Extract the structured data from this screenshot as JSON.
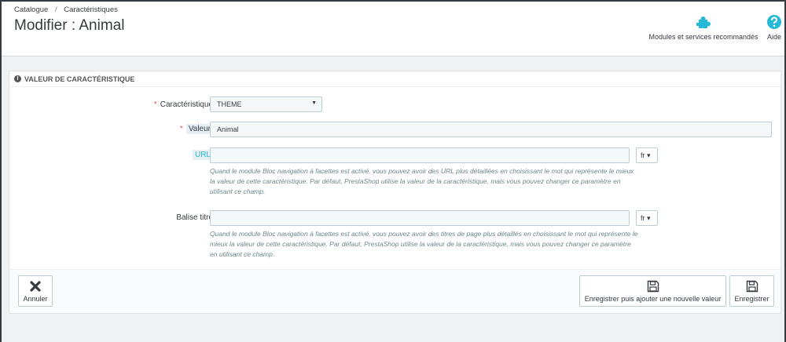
{
  "breadcrumb": {
    "item1": "Catalogue",
    "separator": "/",
    "item2": "Caractéristiques"
  },
  "page_title": "Modifier : Animal",
  "toolbar": {
    "modules_label": "Modules et services recommandés",
    "help_label": "Aide"
  },
  "panel": {
    "heading": "VALEUR DE CARACTÉRISTIQUE",
    "info_glyph": "i",
    "fields": {
      "feature": {
        "required_mark": "*",
        "label": "Caractéristique",
        "selected": "THEME",
        "caret": "▼"
      },
      "value": {
        "required_mark": "*",
        "label": "Valeur",
        "value": "Animal"
      },
      "url": {
        "label": "URL",
        "value": "",
        "lang": "fr ▾",
        "help": "Quand le module Bloc navigation à facettes est activé, vous pouvez avoir des URL plus détaillées en choisissant le mot qui représente le mieux la valeur de cette caractéristique. Par défaut, PrestaShop utilise la valeur de la caractéristique, mais vous pouvez changer ce paramètre en utilisant ce champ."
      },
      "meta_title": {
        "label": "Balise titre",
        "value": "",
        "lang": "fr ▾",
        "help": "Quand le module Bloc navigation à facettes est activé, vous pouvez avoir des titres de page plus détaillés en choisissant le mot qui représente le mieux la valeur de cette caractéristique. Par défaut, PrestaShop utilise la valeur de la caractéristique, mais vous pouvez changer ce paramètre en utilisant ce champ."
      }
    }
  },
  "footer": {
    "cancel_label": "Annuler",
    "save_and_add_label": "Enregistrer puis ajouter une nouvelle valeur",
    "save_label": "Enregistrer"
  },
  "colors": {
    "accent": "#25b9d7",
    "required": "#e0584c",
    "text": "#363a41",
    "background": "#eff1f2"
  },
  "icons": {
    "modules": "puzzle-icon",
    "help": "question-circle-icon",
    "info": "info-circle-icon",
    "cancel": "close-icon",
    "save": "floppy-disk-icon"
  }
}
